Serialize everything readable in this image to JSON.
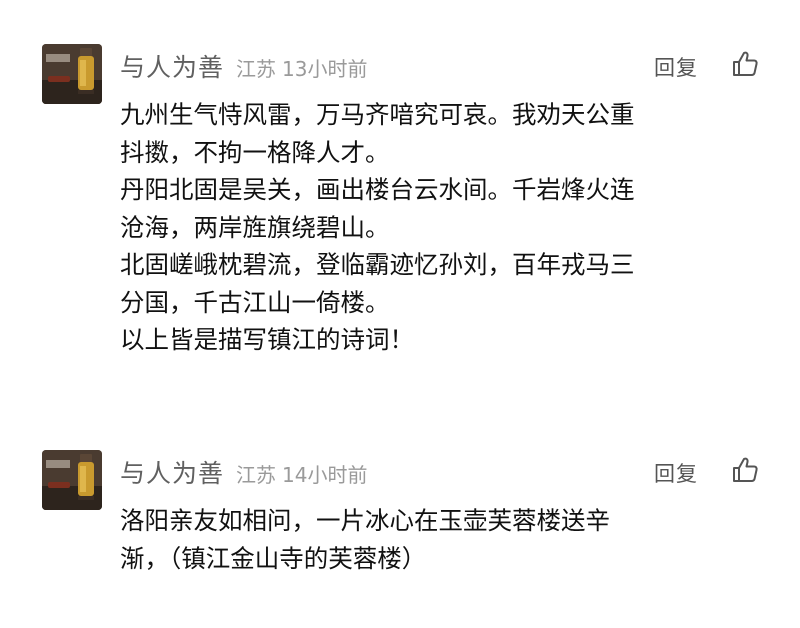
{
  "comments": [
    {
      "username": "与人为善",
      "location": "江苏",
      "time": "13小时前",
      "reply_label": "回复",
      "like_icon": "thumbs-up-icon",
      "avatar_icon": "avatar-oil-bottle-image",
      "lines": [
        "九州生气恃风雷，万马齐喑究可哀。我劝天公重",
        "抖擞，不拘一格降人才。",
        "丹阳北固是吴关，画出楼台云水间。千岩烽火连",
        "沧海，两岸旌旗绕碧山。",
        "北固嵯峨枕碧流，登临霸迹忆孙刘，百年戎马三",
        "分国，千古江山一倚楼。",
        "以上皆是描写镇江的诗词！"
      ]
    },
    {
      "username": "与人为善",
      "location": "江苏",
      "time": "14小时前",
      "reply_label": "回复",
      "like_icon": "thumbs-up-icon",
      "avatar_icon": "avatar-oil-bottle-image",
      "lines": [
        "洛阳亲友如相问，一片冰心在玉壶芙蓉楼送辛",
        "渐，（镇江金山寺的芙蓉楼）"
      ]
    }
  ],
  "colors": {
    "username": "#606060",
    "meta": "#9a9a9a",
    "body": "#111111",
    "background": "#ffffff"
  }
}
